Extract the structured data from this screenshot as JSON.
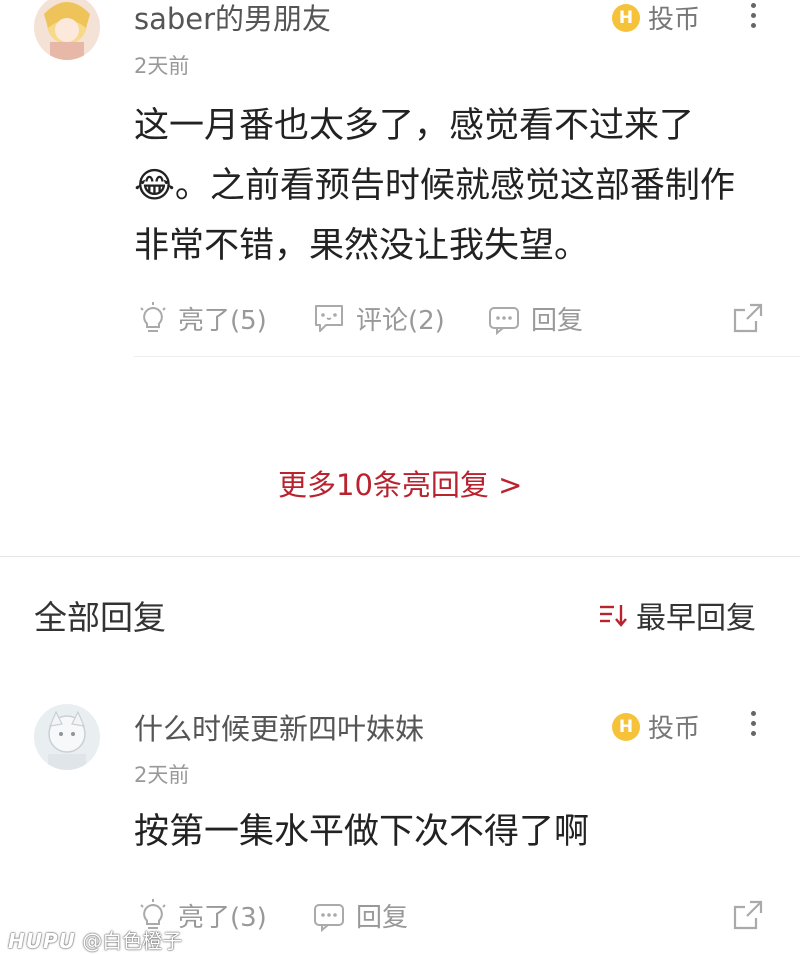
{
  "comments": [
    {
      "username": "saber的男朋友",
      "time": "2天前",
      "coin_label": "投币",
      "text_lines": [
        "这一月番也太多了，感觉看不过来了",
        "😂。之前看预告时候就感觉这部番制作",
        "非常不错，果然没让我失望。"
      ],
      "light_label": "亮了(5)",
      "comment_label": "评论(2)",
      "reply_label": "回复"
    },
    {
      "username": "什么时候更新四叶妹妹",
      "time": "2天前",
      "coin_label": "投币",
      "text_lines": [
        "按第一集水平做下次不得了啊"
      ],
      "light_label": "亮了(3)",
      "reply_label": "回复"
    }
  ],
  "more_replies_label": "更多10条亮回复 >",
  "all_replies": {
    "title": "全部回复",
    "sort_label": "最早回复"
  },
  "watermark": {
    "brand": "HUPU",
    "handle": "@白色橙子"
  },
  "colors": {
    "accent_red": "#b8232f",
    "coin_yellow": "#f5c23a"
  },
  "icons": [
    "coin-icon",
    "more-icon",
    "lightbulb-icon",
    "comment-icon",
    "reply-icon",
    "share-icon",
    "sort-icon"
  ]
}
